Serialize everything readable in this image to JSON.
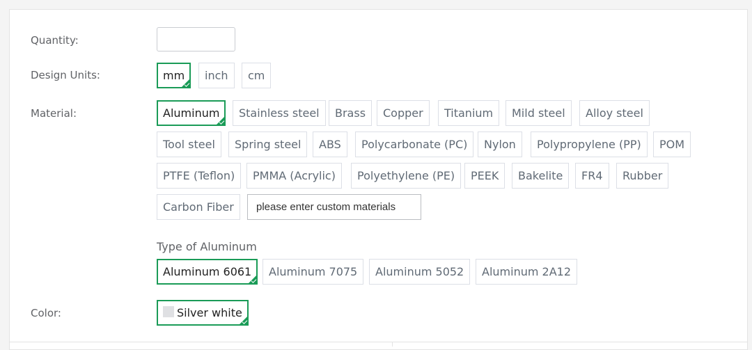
{
  "quantity": {
    "label": "Quantity:",
    "value": "",
    "placeholder": ""
  },
  "design_units": {
    "label": "Design Units:",
    "options": [
      "mm",
      "inch",
      "cm"
    ],
    "selected": "mm"
  },
  "material": {
    "label": "Material:",
    "options": [
      "Aluminum",
      "Stainless steel",
      "Brass",
      "Copper",
      "Titanium",
      "Mild steel",
      "Alloy steel",
      "Tool steel",
      "Spring steel",
      "ABS",
      "Polycarbonate (PC)",
      "Nylon",
      "Polypropylene (PP)",
      "POM",
      "PTFE (Teflon)",
      "PMMA (Acrylic)",
      "Polyethylene (PE)",
      "PEEK",
      "Bakelite",
      "FR4",
      "Rubber",
      "Carbon Fiber"
    ],
    "selected": "Aluminum",
    "custom_placeholder": "please enter custom materials"
  },
  "material_type": {
    "label": "Type of Aluminum",
    "options": [
      "Aluminum 6061",
      "Aluminum 7075",
      "Aluminum 5052",
      "Aluminum 2A12"
    ],
    "selected": "Aluminum 6061"
  },
  "color": {
    "label": "Color:",
    "options": [
      "Silver white"
    ],
    "selected": "Silver white",
    "swatch_hex": "#dfe0e3"
  },
  "accent_color": "#1a9b57"
}
